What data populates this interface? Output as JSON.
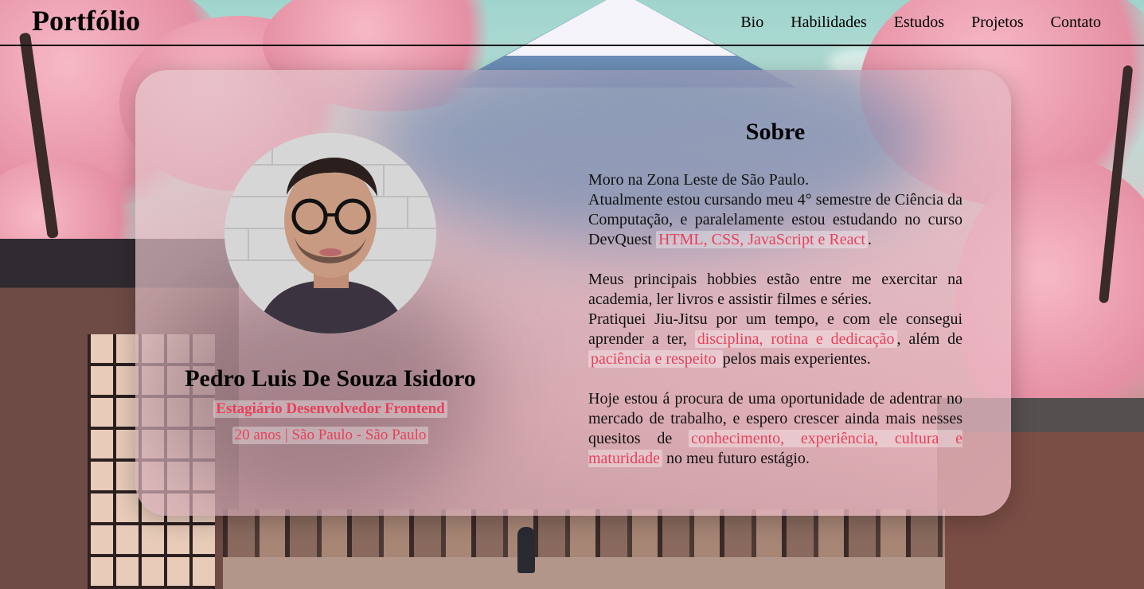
{
  "header": {
    "logo": "Portfólio",
    "nav": [
      "Bio",
      "Habilidades",
      "Estudos",
      "Projetos",
      "Contato"
    ]
  },
  "profile": {
    "name": "Pedro Luis De Souza Isidoro",
    "role": "Estagiário Desenvolvedor Frontend",
    "details": "20 anos | São Paulo - São Paulo"
  },
  "about": {
    "title": "Sobre",
    "p1_line1": "Moro na Zona Leste de São Paulo.",
    "p1_line2_text": "Atualmente estou cursando meu 4° semestre de Ciência da Computação, e paralelamente estou estudando no curso DevQuest ",
    "p1_line2_highlight": "HTML, CSS, JavaScript e React",
    "p1_line2_end": ".",
    "p2_line1": "Meus principais hobbies estão entre me exercitar na academia, ler livros e assistir filmes e séries.",
    "p2_line2_text": "Pratiquei Jiu-Jitsu por um tempo, e com ele consegui aprender a ter, ",
    "p2_line2_highlight1": "disciplina, rotina e dedicação",
    "p2_line2_mid": ", além de ",
    "p2_line2_highlight2": "paciência e respeito ",
    "p2_line2_end": " pelos mais experientes.",
    "p3_text": "Hoje estou á procura de uma oportunidade de adentrar no mercado de trabalho, e espero crescer ainda mais nesses quesitos de ",
    "p3_highlight": "conhecimento, experiência, cultura e maturidade",
    "p3_end": " no meu futuro estágio."
  },
  "colors": {
    "accent": "#e8405a",
    "text": "#000000"
  }
}
